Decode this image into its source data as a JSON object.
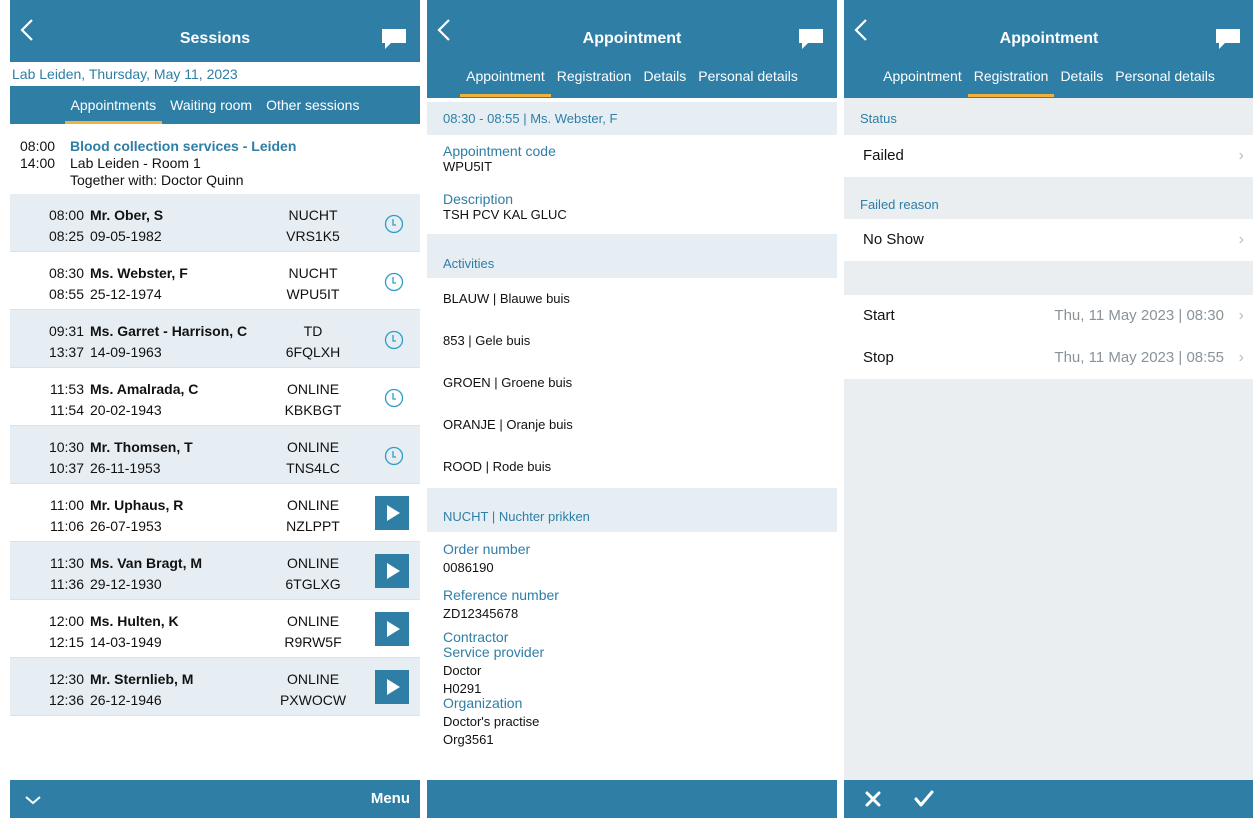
{
  "panel1": {
    "title": "Sessions",
    "lab_line": "Lab Leiden, Thursday, May 11, 2023",
    "tabs": [
      "Appointments",
      "Waiting room",
      "Other sessions"
    ],
    "session": {
      "start": "08:00",
      "end": "14:00",
      "title": "Blood collection services - Leiden",
      "room": "Lab Leiden - Room 1",
      "together": "Together with: Doctor Quinn"
    },
    "appointments": [
      {
        "t1": "08:00",
        "t2": "08:25",
        "name": "Mr. Ober, S",
        "dob": "09-05-1982",
        "c1": "NUCHT",
        "c2": "VRS1K5",
        "action": "clock"
      },
      {
        "t1": "08:30",
        "t2": "08:55",
        "name": "Ms. Webster, F",
        "dob": "25-12-1974",
        "c1": "NUCHT",
        "c2": "WPU5IT",
        "action": "clock"
      },
      {
        "t1": "09:31",
        "t2": "13:37",
        "name": "Ms. Garret - Harrison, C",
        "dob": "14-09-1963",
        "c1": "TD",
        "c2": "6FQLXH",
        "action": "clock"
      },
      {
        "t1": "11:53",
        "t2": "11:54",
        "name": "Ms. Amalrada, C",
        "dob": "20-02-1943",
        "c1": "ONLINE",
        "c2": "KBKBGT",
        "action": "clock"
      },
      {
        "t1": "10:30",
        "t2": "10:37",
        "name": "Mr. Thomsen, T",
        "dob": "26-11-1953",
        "c1": "ONLINE",
        "c2": "TNS4LC",
        "action": "clock"
      },
      {
        "t1": "11:00",
        "t2": "11:06",
        "name": "Mr. Uphaus, R",
        "dob": "26-07-1953",
        "c1": "ONLINE",
        "c2": "NZLPPT",
        "action": "play"
      },
      {
        "t1": "11:30",
        "t2": "11:36",
        "name": "Ms. Van Bragt, M",
        "dob": "29-12-1930",
        "c1": "ONLINE",
        "c2": "6TGLXG",
        "action": "play"
      },
      {
        "t1": "12:00",
        "t2": "12:15",
        "name": "Ms. Hulten, K",
        "dob": "14-03-1949",
        "c1": "ONLINE",
        "c2": "R9RW5F",
        "action": "play"
      },
      {
        "t1": "12:30",
        "t2": "12:36",
        "name": "Mr. Sternlieb, M",
        "dob": "26-12-1946",
        "c1": "ONLINE",
        "c2": "PXWOCW",
        "action": "play"
      }
    ],
    "menu_label": "Menu"
  },
  "panel2": {
    "title": "Appointment",
    "tabs": [
      "Appointment",
      "Registration",
      "Details",
      "Personal details"
    ],
    "header_line": "08:30 - 08:55 | Ms. Webster, F",
    "code_label": "Appointment code",
    "code_value": "WPU5IT",
    "desc_label": "Description",
    "desc_value": "TSH PCV KAL GLUC",
    "activities_head": "Activities",
    "activities": [
      "BLAUW | Blauwe buis",
      "853 | Gele buis",
      "GROEN | Groene buis",
      "ORANJE | Oranje buis",
      "ROOD | Rode buis"
    ],
    "nucht_head": "NUCHT | Nuchter prikken",
    "order_label": "Order number",
    "order_value": "0086190",
    "ref_label": "Reference number",
    "ref_value": "ZD12345678",
    "contractor_label": "Contractor",
    "provider_label": "Service provider",
    "provider_name": "Doctor",
    "provider_code": "H0291",
    "org_label": "Organization",
    "org_name": "Doctor's practise",
    "org_code": "Org3561"
  },
  "panel3": {
    "title": "Appointment",
    "tabs": [
      "Appointment",
      "Registration",
      "Details",
      "Personal details"
    ],
    "status_head": "Status",
    "status_value": "Failed",
    "failed_head": "Failed reason",
    "failed_value": "No Show",
    "start_label": "Start",
    "start_value": "Thu, 11 May 2023 | 08:30",
    "stop_label": "Stop",
    "stop_value": "Thu, 11 May 2023 | 08:55"
  },
  "colors": {
    "accent": "#2e7ea6",
    "tab_indicator": "#f0b23a",
    "row_shade": "#e6eef3"
  }
}
